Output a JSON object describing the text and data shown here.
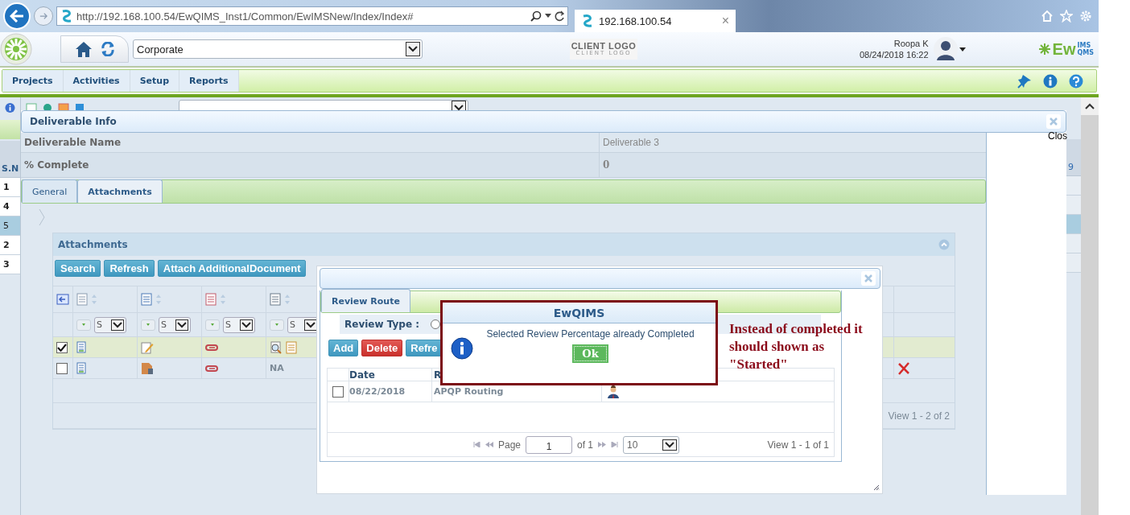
{
  "browser": {
    "url": "http://192.168.100.54/EwQIMS_Inst1/Common/EwIMSNew/Index/Index#",
    "tabs": [
      {
        "title": "192.168.100.54",
        "selected": true
      }
    ],
    "tab_close": "×"
  },
  "header": {
    "org_select": "Corporate",
    "client_logo": "CLIENT LOGO",
    "client_logo_tagline": "CLIENT LOGO",
    "user_name": "Roopa K",
    "datetime": "08/24/2018 16:22",
    "brand": {
      "main": "Ew",
      "top": "IMS",
      "bottom": "QMS"
    }
  },
  "menu": [
    {
      "label": "Projects"
    },
    {
      "label": "Activities"
    },
    {
      "label": "Setup"
    },
    {
      "label": "Reports"
    }
  ],
  "background": {
    "sn_header": "S.N",
    "rows": [
      {
        "sn": "1",
        "selected": false
      },
      {
        "sn": "4",
        "selected": false
      },
      {
        "sn": "5",
        "selected": true
      },
      {
        "sn": "2",
        "selected": false
      },
      {
        "sn": "3",
        "selected": false
      }
    ],
    "right_header": "9",
    "close_label": "Clos"
  },
  "deliverable_dialog": {
    "title": "Deliverable Info",
    "fields": [
      {
        "label": "Deliverable Name",
        "value": "Deliverable 3"
      },
      {
        "label": "% Complete",
        "value": "0"
      }
    ],
    "tabs": [
      {
        "label": "General",
        "selected": false
      },
      {
        "label": "Attachments",
        "selected": true
      }
    ],
    "attachments": {
      "title": "Attachments",
      "buttons": [
        "Search",
        "Refresh",
        "Attach AdditionalDocument"
      ],
      "filters": [
        "S",
        "S",
        "S",
        "S"
      ],
      "rows": [
        {
          "kind": "preview",
          "checked": true,
          "selected": true,
          "deletable": false
        },
        {
          "kind": "missing",
          "checked": false,
          "selected": false,
          "view": "NA",
          "deletable": true
        }
      ],
      "pager": "View 1 - 2 of 2"
    }
  },
  "review_dialog": {
    "tabs": [
      {
        "label": "Review Route",
        "selected": true
      }
    ],
    "review_type_label": "Review Type :",
    "review_type_selected": false,
    "buttons": [
      {
        "label": "Add",
        "kind": "primary"
      },
      {
        "label": "Delete",
        "kind": "danger"
      },
      {
        "label": "Refre",
        "kind": "primary"
      }
    ],
    "columns": [
      "Date",
      "R"
    ],
    "rows": [
      {
        "checked": false,
        "date": "08/22/2018",
        "route": "APQP Routing"
      }
    ],
    "pager": {
      "page_label": "Page",
      "page": "1",
      "of": "of 1",
      "page_size": "10",
      "view": "View 1 - 1 of 1"
    }
  },
  "alert": {
    "title": "EwQIMS",
    "message": "Selected Review Percentage already Completed",
    "button": "Ok"
  },
  "annotation": "Instead of completed it should shown as \"Started\""
}
